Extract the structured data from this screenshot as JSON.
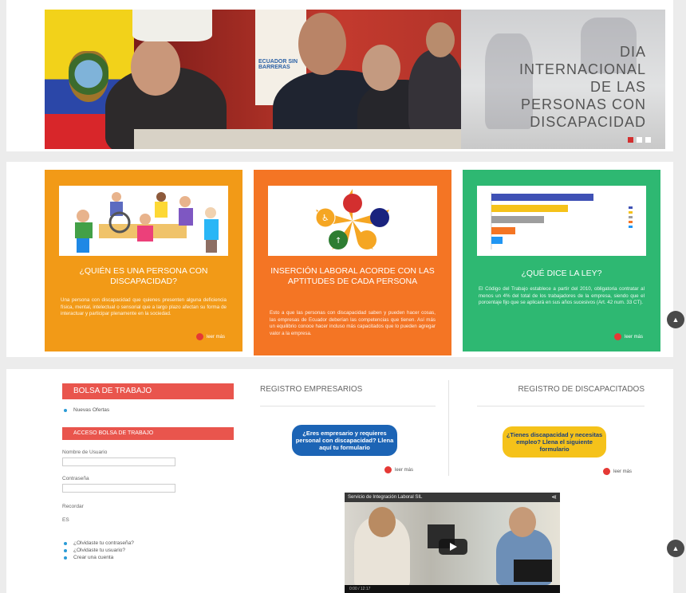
{
  "hero": {
    "caption_lines": [
      "DIA",
      "INTERNACIONAL",
      "DE LAS",
      "PERSONAS CON",
      "DISCAPACIDAD"
    ],
    "banner_text": "ECUADOR SIN BARRERAS",
    "slide_dots": 3,
    "active_dot": 0
  },
  "cards": [
    {
      "title": "¿QUIÉN ES UNA PERSONA CON DISCAPACIDAD?",
      "text": "Una persona con discapacidad que quienes presenten alguna deficiencia física, mental, intelectual o sensorial que a largo plazo afectan su forma de interactuar y participar plenamente en la sociedad.",
      "more": "leer más",
      "color": "#f29a17"
    },
    {
      "title": "INSERCIÓN LABORAL ACORDE CON LAS APTITUDES DE CADA PERSONA",
      "text": "Esto a que las personas con discapacidad saben y pueden hacer cosas, las empresas de Ecuador deberían las competencias que tienen. Así más un equilibrio conoce hacer incluso más capacitados que lo pueden agregar valor a la empresa.",
      "more": "leer más",
      "color": "#f47524"
    },
    {
      "title": "¿QUÉ DICE LA LEY?",
      "text": "El Código del Trabajo establece a partir del 2010, obligatoria contratar al menos un 4% del total de los trabajadores de la empresa, siendo que el porcentaje fijo que se aplicará en sus años sucesivos (Art. 42 num. 33 CT).",
      "more": "leer más",
      "color": "#2eb872"
    }
  ],
  "chart_colors": [
    "#3f51b5",
    "#f5c21a",
    "#9e9e9e",
    "#f47524",
    "#2196f3"
  ],
  "sidebar": {
    "bolsa_title": "BOLSA DE TRABAJO",
    "bolsa_item": "Nuevas Ofertas",
    "acceso_title": "ACCESO BOLSA DE TRABAJO",
    "usuario_label": "Nombre de Usuario",
    "password_label": "Contraseña",
    "recordar_label": "Recordar",
    "submit_label": "ES",
    "links": [
      "¿Olvidaste tu contraseña?",
      "¿Olvidaste tu usuario?",
      "Crear una cuenta"
    ]
  },
  "registro": {
    "empresarios_title": "REGISTRO EMPRESARIOS",
    "empresarios_pill": "¿Eres empresario y requieres personal con discapacidad? Llena aquí tu formulario",
    "empresarios_more": "leer más",
    "discapacitados_title": "REGISTRO DE DISCAPACITADOS",
    "discapacitados_pill": "¿Tienes discapacidad y necesitas empleo? Llena el siguiente formulario",
    "discapacitados_more": "leer más"
  },
  "video": {
    "title": "Servicio de Integración Laboral SIL",
    "time": "0:00 / 12:17"
  }
}
